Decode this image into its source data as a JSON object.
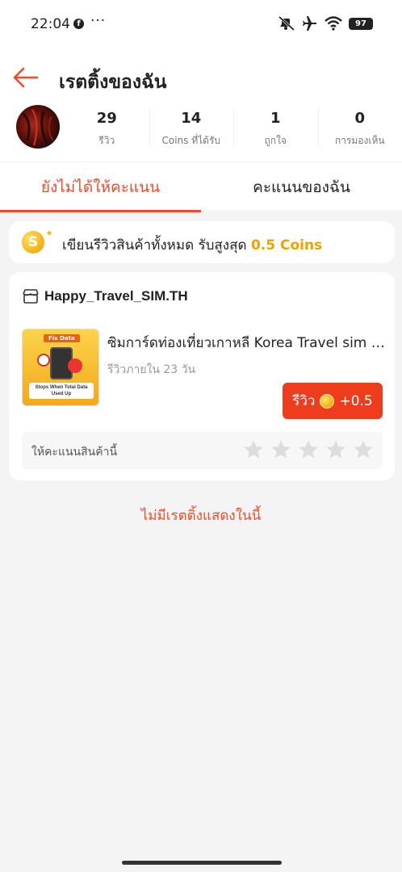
{
  "status_bar": {
    "time": "22:04",
    "fb_glyph": "f",
    "more": "···",
    "battery": "97",
    "icons": [
      "mute-icon",
      "airplane-icon",
      "wifi-icon",
      "battery-icon"
    ]
  },
  "header": {
    "title": "เรตติ้งของฉัน",
    "accent_color": "#ee4d2d"
  },
  "profile": {
    "stats": [
      {
        "value": "29",
        "label": "รีวิว"
      },
      {
        "value": "14",
        "label": "Coins ที่ได้รับ"
      },
      {
        "value": "1",
        "label": "ถูกใจ"
      },
      {
        "value": "0",
        "label": "การมองเห็น"
      }
    ]
  },
  "tabs": [
    {
      "label": "ยังไม่ได้ให้คะแนน",
      "active": true
    },
    {
      "label": "คะแนนของฉัน",
      "active": false
    }
  ],
  "banner": {
    "coin_glyph": "S",
    "sparkle": "✦",
    "text": "เขียนรีวิวสินค้าทั้งหมด รับสูงสุด",
    "highlight": "0.5 Coins"
  },
  "order": {
    "shop_name": "Happy_Travel_SIM.TH",
    "product_image": {
      "tag": "Fix Data",
      "caption": "Stops When Total Data Used Up"
    },
    "product_title": "ซิมการ์ดท่องเที่ยวเกาหลี Korea Travel sim card",
    "deadline": "รีวิวภายใน 23 วัน",
    "review_button": {
      "label": "รีวิว",
      "reward": "+0.5"
    },
    "rate_label": "ให้คะแนนสินค้านี้",
    "stars_total": 5,
    "stars_filled": 0
  },
  "empty_note": "ไม่มีเรตติ้งแสดงในนี้"
}
